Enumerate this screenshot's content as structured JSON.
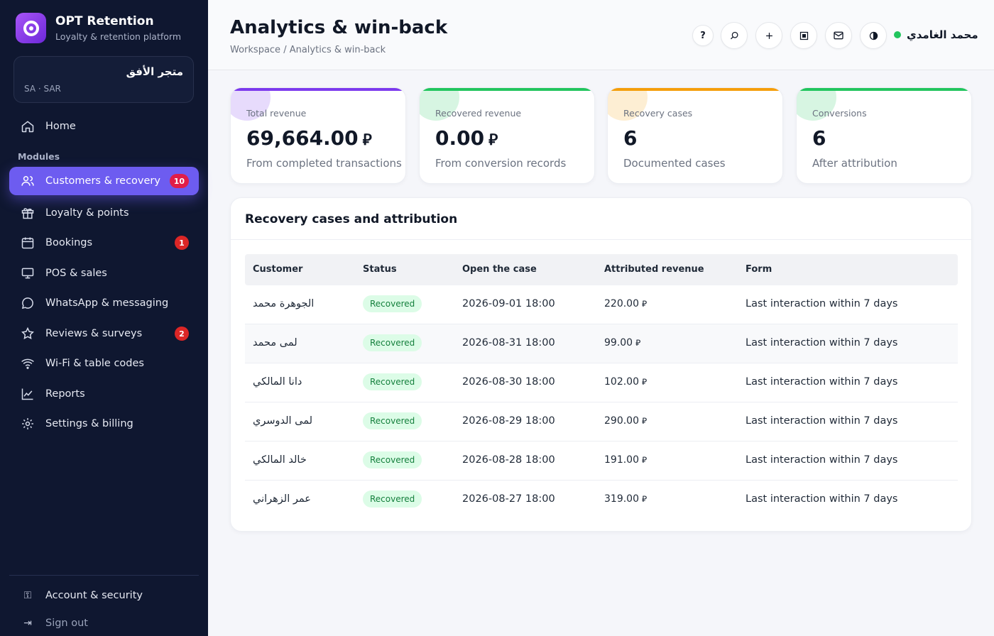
{
  "brand": {
    "title": "OPT Retention",
    "subtitle": "Loyalty & retention platform"
  },
  "store": {
    "name": "متجر الأفق",
    "meta": "SA · SAR"
  },
  "nav": {
    "home": "Home",
    "section_label": "Modules",
    "items": [
      {
        "label": "Customers & recovery",
        "badge": "10",
        "icon": "users-icon",
        "active": true
      },
      {
        "label": "Loyalty & points",
        "badge": "",
        "icon": "gift-icon"
      },
      {
        "label": "Bookings",
        "badge": "1",
        "icon": "calendar-icon"
      },
      {
        "label": "POS & sales",
        "badge": "",
        "icon": "monitor-icon"
      },
      {
        "label": "WhatsApp & messaging",
        "badge": "",
        "icon": "chat-icon"
      },
      {
        "label": "Reviews & surveys",
        "badge": "2",
        "icon": "star-icon"
      },
      {
        "label": "Wi-Fi & table codes",
        "badge": "",
        "icon": "wifi-icon"
      },
      {
        "label": "Reports",
        "badge": "",
        "icon": "chart-icon"
      },
      {
        "label": "Settings & billing",
        "badge": "",
        "icon": "gear-icon"
      }
    ],
    "account": "Account & security",
    "signout": "Sign out"
  },
  "header": {
    "title": "Analytics & win-back",
    "breadcrumb": "Workspace / Analytics & win-back",
    "help": "?",
    "user_name": "محمد الغامدي"
  },
  "stats": [
    {
      "label": "Total revenue",
      "value": "69,664.00",
      "currency": "⃁",
      "sub": "From completed transactions",
      "color": "#7c3aed"
    },
    {
      "label": "Recovered revenue",
      "value": "0.00",
      "currency": "⃁",
      "sub": "From conversion records",
      "color": "#22c55e"
    },
    {
      "label": "Recovery cases",
      "value": "6",
      "currency": "",
      "sub": "Documented cases",
      "color": "#f59e0b"
    },
    {
      "label": "Conversions",
      "value": "6",
      "currency": "",
      "sub": "After attribution",
      "color": "#22c55e"
    }
  ],
  "table": {
    "title": "Recovery cases and attribution",
    "columns": [
      "Customer",
      "Status",
      "Open the case",
      "Attributed revenue",
      "Form"
    ],
    "rows": [
      {
        "customer": "الجوهرة محمد",
        "status": "Recovered",
        "opened": "2026-09-01 18:00",
        "revenue": "220.00",
        "form": "Last interaction within 7 days"
      },
      {
        "customer": "لمى محمد",
        "status": "Recovered",
        "opened": "2026-08-31 18:00",
        "revenue": "99.00",
        "form": "Last interaction within 7 days"
      },
      {
        "customer": "دانا المالكي",
        "status": "Recovered",
        "opened": "2026-08-30 18:00",
        "revenue": "102.00",
        "form": "Last interaction within 7 days"
      },
      {
        "customer": "لمى الدوسري",
        "status": "Recovered",
        "opened": "2026-08-29 18:00",
        "revenue": "290.00",
        "form": "Last interaction within 7 days"
      },
      {
        "customer": "خالد المالكي",
        "status": "Recovered",
        "opened": "2026-08-28 18:00",
        "revenue": "191.00",
        "form": "Last interaction within 7 days"
      },
      {
        "customer": "عمر الزهراني",
        "status": "Recovered",
        "opened": "2026-08-27 18:00",
        "revenue": "319.00",
        "form": "Last interaction within 7 days"
      }
    ],
    "currency": "⃁"
  }
}
